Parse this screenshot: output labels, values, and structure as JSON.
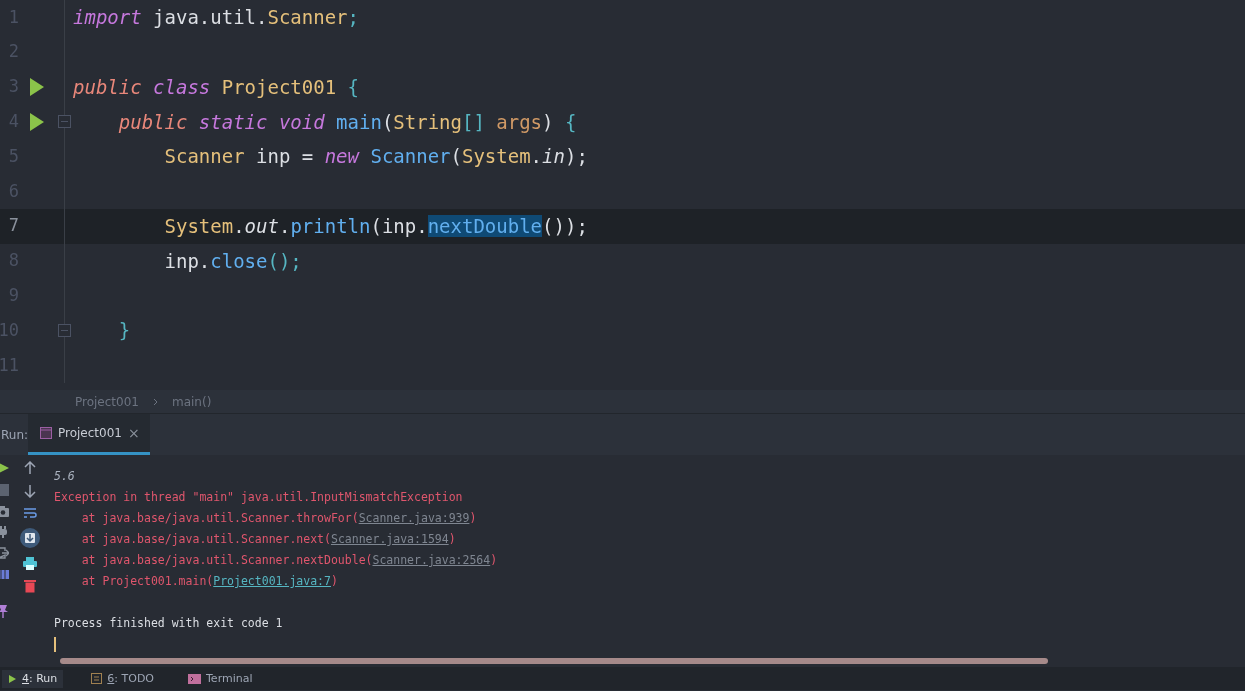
{
  "editor": {
    "lines": [
      {
        "number": "1",
        "run": false,
        "fold": false,
        "current": false,
        "tokens": [
          {
            "kind": "keyword",
            "text": "import"
          },
          {
            "kind": "plain",
            "text": " java.util."
          },
          {
            "kind": "type",
            "text": "Scanner"
          },
          {
            "kind": "punct",
            "text": ";"
          }
        ]
      },
      {
        "number": "2",
        "run": false,
        "fold": false,
        "current": false
      },
      {
        "number": "3",
        "run": true,
        "fold": false,
        "current": false,
        "tokens": [
          {
            "kind": "modifier",
            "text": "public"
          },
          {
            "kind": "keyword",
            "text": " class"
          },
          {
            "kind": "type",
            "text": " Project001"
          },
          {
            "kind": "punct",
            "text": " {"
          }
        ]
      },
      {
        "number": "4",
        "run": true,
        "fold": true,
        "current": false,
        "tokens": [
          {
            "kind": "modifier",
            "text": "    public"
          },
          {
            "kind": "keyword",
            "text": " static"
          },
          {
            "kind": "keyword",
            "text": " void"
          },
          {
            "kind": "method",
            "text": " main"
          },
          {
            "kind": "plain",
            "text": "("
          },
          {
            "kind": "type",
            "text": "String"
          },
          {
            "kind": "punct",
            "text": "[]"
          },
          {
            "kind": "param",
            "text": " args"
          },
          {
            "kind": "plain",
            "text": ") "
          },
          {
            "kind": "punct",
            "text": "{"
          }
        ]
      },
      {
        "number": "5",
        "run": false,
        "fold": false,
        "current": false,
        "tokens": [
          {
            "kind": "type",
            "text": "        Scanner"
          },
          {
            "kind": "plain",
            "text": " inp = "
          },
          {
            "kind": "keyword",
            "text": "new"
          },
          {
            "kind": "method",
            "text": " Scanner"
          },
          {
            "kind": "plain",
            "text": "("
          },
          {
            "kind": "type",
            "text": "System"
          },
          {
            "kind": "plain",
            "text": "."
          },
          {
            "kind": "field",
            "text": "in"
          },
          {
            "kind": "plain",
            "text": ");"
          }
        ]
      },
      {
        "number": "6",
        "run": false,
        "fold": false,
        "current": false
      },
      {
        "number": "7",
        "run": false,
        "fold": false,
        "current": true,
        "tokens": [
          {
            "kind": "type",
            "text": "        System"
          },
          {
            "kind": "plain",
            "text": "."
          },
          {
            "kind": "field",
            "text": "out"
          },
          {
            "kind": "plain",
            "text": "."
          },
          {
            "kind": "method",
            "text": "println"
          },
          {
            "kind": "plain",
            "text": "(inp."
          },
          {
            "kind": "selection",
            "text": "nextDouble"
          },
          {
            "kind": "plain",
            "text": "());"
          }
        ]
      },
      {
        "number": "8",
        "run": false,
        "fold": false,
        "current": false,
        "tokens": [
          {
            "kind": "plain",
            "text": "        inp."
          },
          {
            "kind": "method",
            "text": "close"
          },
          {
            "kind": "punct",
            "text": "();"
          }
        ]
      },
      {
        "number": "9",
        "run": false,
        "fold": false,
        "current": false
      },
      {
        "number": "10",
        "run": false,
        "fold": true,
        "current": false,
        "tokens": [
          {
            "kind": "punct",
            "text": "    }"
          }
        ]
      },
      {
        "number": "11",
        "run": false,
        "fold": false,
        "current": false
      }
    ]
  },
  "breadcrumbs": [
    "Project001",
    "main()"
  ],
  "run_panel": {
    "label": "Run:",
    "tabs": [
      {
        "label": "Project001",
        "selected": true,
        "close": "×"
      }
    ],
    "console": [
      {
        "kind": "input",
        "parts": [
          {
            "text": "5.6"
          }
        ]
      },
      {
        "kind": "error",
        "parts": [
          {
            "text": "Exception in thread \"main\" java.util.InputMismatchException"
          }
        ]
      },
      {
        "kind": "error",
        "parts": [
          {
            "text": "    at java.base/java.util.Scanner.throwFor("
          },
          {
            "kind": "library_link",
            "text": "Scanner.java:939"
          },
          {
            "text": ")"
          }
        ]
      },
      {
        "kind": "error",
        "parts": [
          {
            "text": "    at java.base/java.util.Scanner.next("
          },
          {
            "kind": "library_link",
            "text": "Scanner.java:1594"
          },
          {
            "text": ")"
          }
        ]
      },
      {
        "kind": "error",
        "parts": [
          {
            "text": "    at java.base/java.util.Scanner.nextDouble("
          },
          {
            "kind": "library_link",
            "text": "Scanner.java:2564"
          },
          {
            "text": ")"
          }
        ]
      },
      {
        "kind": "error",
        "parts": [
          {
            "text": "    at Project001.main("
          },
          {
            "kind": "project_link",
            "text": "Project001.java:7"
          },
          {
            "text": ")"
          }
        ]
      },
      {
        "kind": "blank"
      },
      {
        "kind": "plain",
        "parts": [
          {
            "text": "Process finished with exit code 1"
          }
        ]
      }
    ]
  },
  "bottom_tabs": [
    {
      "mnemonic": "4",
      "label": ": Run",
      "selected": true
    },
    {
      "mnemonic": "6",
      "label": ": TODO",
      "selected": false
    },
    {
      "label": "Terminal",
      "selected": false
    }
  ]
}
